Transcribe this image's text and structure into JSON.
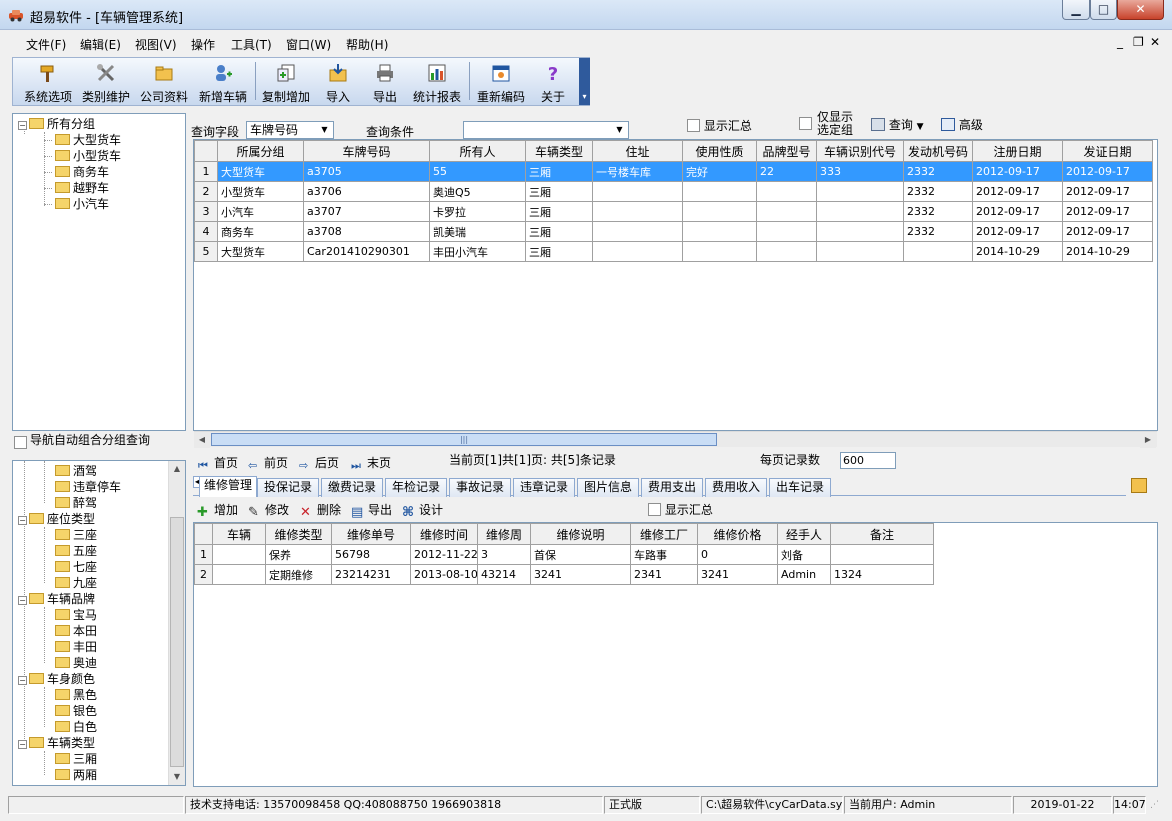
{
  "window": {
    "title": "超易软件 - [车辆管理系统]"
  },
  "menu": [
    "文件(F)",
    "编辑(E)",
    "视图(V)",
    "操作",
    "工具(T)",
    "窗口(W)",
    "帮助(H)"
  ],
  "toolbar": [
    "系统选项",
    "类别维护",
    "公司资料",
    "新增车辆",
    "复制增加",
    "导入",
    "导出",
    "统计报表",
    "重新编码",
    "关于"
  ],
  "group_tree": {
    "root": "所有分组",
    "children": [
      "大型货车",
      "小型货车",
      "商务车",
      "越野车",
      "小汽车"
    ]
  },
  "nav_auto_label": "导航自动组合分组查询",
  "category_tree": {
    "top_items": [
      "酒驾",
      "违章停车",
      "醉驾"
    ],
    "groups": [
      {
        "name": "座位类型",
        "items": [
          "三座",
          "五座",
          "七座",
          "九座"
        ]
      },
      {
        "name": "车辆品牌",
        "items": [
          "宝马",
          "本田",
          "丰田",
          "奥迪"
        ]
      },
      {
        "name": "车身颜色",
        "items": [
          "黑色",
          "银色",
          "白色"
        ]
      },
      {
        "name": "车辆类型",
        "items": [
          "三厢",
          "两厢"
        ]
      }
    ]
  },
  "query": {
    "field_label": "查询字段",
    "field_value": "车牌号码",
    "cond_label": "查询条件",
    "cond_value": "",
    "show_summary": "显示汇总",
    "only_selected": "仅显示选定组",
    "search_btn": "查询",
    "advanced_btn": "高级"
  },
  "main_table": {
    "columns": [
      "所属分组",
      "车牌号码",
      "所有人",
      "车辆类型",
      "住址",
      "使用性质",
      "品牌型号",
      "车辆识别代号",
      "发动机号码",
      "注册日期",
      "发证日期"
    ],
    "rows": [
      [
        "1",
        "大型货车",
        "a3705",
        "55",
        "三厢",
        "一号楼车库",
        "完好",
        "22",
        "333",
        "2332",
        "2012-09-17",
        "2012-09-17"
      ],
      [
        "2",
        "小型货车",
        "a3706",
        "奥迪Q5",
        "三厢",
        "",
        "",
        "",
        "",
        "2332",
        "2012-09-17",
        "2012-09-17"
      ],
      [
        "3",
        "小汽车",
        "a3707",
        "卡罗拉",
        "三厢",
        "",
        "",
        "",
        "",
        "2332",
        "2012-09-17",
        "2012-09-17"
      ],
      [
        "4",
        "商务车",
        "a3708",
        "凯美瑞",
        "三厢",
        "",
        "",
        "",
        "",
        "2332",
        "2012-09-17",
        "2012-09-17"
      ],
      [
        "5",
        "大型货车",
        "Car201410290301",
        "丰田小汽车",
        "三厢",
        "",
        "",
        "",
        "",
        "",
        "2014-10-29",
        "2014-10-29"
      ]
    ],
    "selected_row": 0
  },
  "pager": {
    "first": "首页",
    "prev": "前页",
    "next": "后页",
    "last": "末页",
    "status": "当前页[1]共[1]页: 共[5]条记录",
    "per_page_label": "每页记录数",
    "per_page_value": "600"
  },
  "tabs": [
    "维修管理",
    "投保记录",
    "缴费记录",
    "年检记录",
    "事故记录",
    "违章记录",
    "图片信息",
    "费用支出",
    "费用收入",
    "出车记录"
  ],
  "active_tab": 0,
  "sub_toolbar": {
    "add": "增加",
    "edit": "修改",
    "delete": "删除",
    "export": "导出",
    "design": "设计",
    "show_summary": "显示汇总"
  },
  "sub_table": {
    "columns": [
      "车辆",
      "维修类型",
      "维修单号",
      "维修时间",
      "维修周",
      "维修说明",
      "维修工厂",
      "维修价格",
      "经手人",
      "备注"
    ],
    "rows": [
      [
        "1",
        "",
        "保养",
        "56798",
        "2012-11-22",
        "3",
        "首保",
        "车路事",
        "0",
        "刘备",
        ""
      ],
      [
        "2",
        "",
        "定期维修",
        "23214231",
        "2013-08-10",
        "43214",
        "3241",
        "2341",
        "3241",
        "Admin",
        "1324"
      ]
    ]
  },
  "status": {
    "support": "技术支持电话: 13570098458 QQ:408088750 1966903818",
    "edition": "正式版",
    "db_path": "C:\\超易软件\\cyCarData.sys",
    "user": "当前用户: Admin",
    "date": "2019-01-22",
    "time": "14:07"
  }
}
